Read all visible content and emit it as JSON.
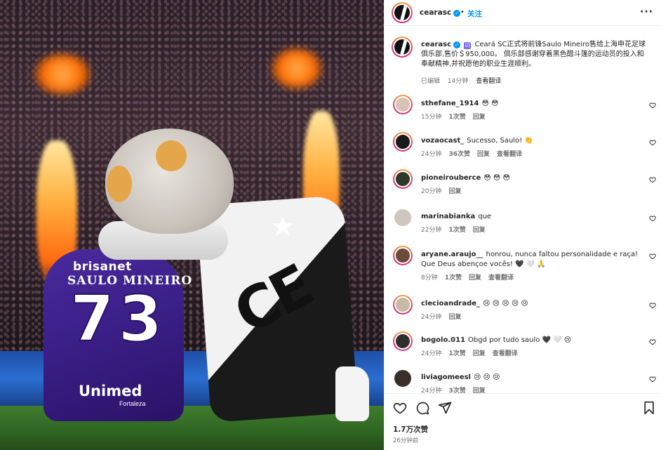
{
  "header": {
    "username": "cearasc",
    "separator": "•",
    "follow_label": "关注",
    "more_label": "···",
    "verified_mark": "✓"
  },
  "photo": {
    "sponsor": "brisanet",
    "player_name": "SAULO MINEIRO",
    "number": "73",
    "bottom_sponsor": "Unimed",
    "city": "Fortaleza",
    "mascot_letters": "CE",
    "star": "★"
  },
  "caption": {
    "username": "cearasc",
    "verified_mark": "✓",
    "checkbox": "☑",
    "text": " Ceará SC正式将前锋Saulo Mineiro售给上海申花足球俱乐部,售价＄950,000。 俱乐部感谢穿着黑色醋斗篷的运动员的投入和奉献精神,并祝愿他的职业生涯顺利。",
    "edited": "已编辑",
    "time": "14分钟",
    "translate": "查看翻译"
  },
  "comments": [
    {
      "username": "sthefane_1914",
      "text": "😳 😳",
      "time": "15分钟",
      "likes": "1次赞",
      "reply": "回复",
      "translate": "",
      "avatar_color": "#d8c2b4",
      "ring": true
    },
    {
      "username": "vozaocast_",
      "text": "Sucesso, Saulo! 👏",
      "time": "24分钟",
      "likes": "36次赞",
      "reply": "回复",
      "translate": "查看翻译",
      "avatar_color": "#1a1a1a",
      "ring": true
    },
    {
      "username": "pioneirouberce",
      "text": "😳 😳 😳",
      "time": "20分钟",
      "likes": "",
      "reply": "回复",
      "translate": "",
      "avatar_color": "#2d3a2a",
      "ring": true
    },
    {
      "username": "marinabianka",
      "text": "que",
      "time": "22分钟",
      "likes": "1次赞",
      "reply": "回复",
      "translate": "",
      "avatar_color": "#cfc6bf",
      "ring": false
    },
    {
      "username": "aryane.araujo__",
      "text": "honrou, nunca faltou personalidade e raça! Que Deus abençoe vocês! 🖤 🤍 🙏",
      "time": "8分钟",
      "likes": "1次赞",
      "reply": "回复",
      "translate": "查看翻译",
      "avatar_color": "#6b4a3a",
      "ring": true
    },
    {
      "username": "clecioandrade_",
      "text": "😢 😢 😢 😢 😢",
      "time": "24分钟",
      "likes": "",
      "reply": "回复",
      "translate": "",
      "avatar_color": "#c8b8a6",
      "ring": true
    },
    {
      "username": "bogolo.011",
      "text": "Obgd por tudo saulo 🖤 🤍 😢",
      "time": "24分钟",
      "likes": "1次赞",
      "reply": "回复",
      "translate": "查看翻译",
      "avatar_color": "#2e2e2e",
      "ring": true
    },
    {
      "username": "liviagomeesl",
      "text": "😢 😢 😢",
      "time": "24分钟",
      "likes": "3次赞",
      "reply": "回复",
      "translate": "",
      "avatar_color": "#3a2e2a",
      "ring": false
    }
  ],
  "footer": {
    "likes": "1.7万次赞",
    "time": "26分钟前"
  },
  "colors": {
    "accent": "#0095f6",
    "text": "#262626",
    "muted": "#737373",
    "border": "#efefef"
  }
}
